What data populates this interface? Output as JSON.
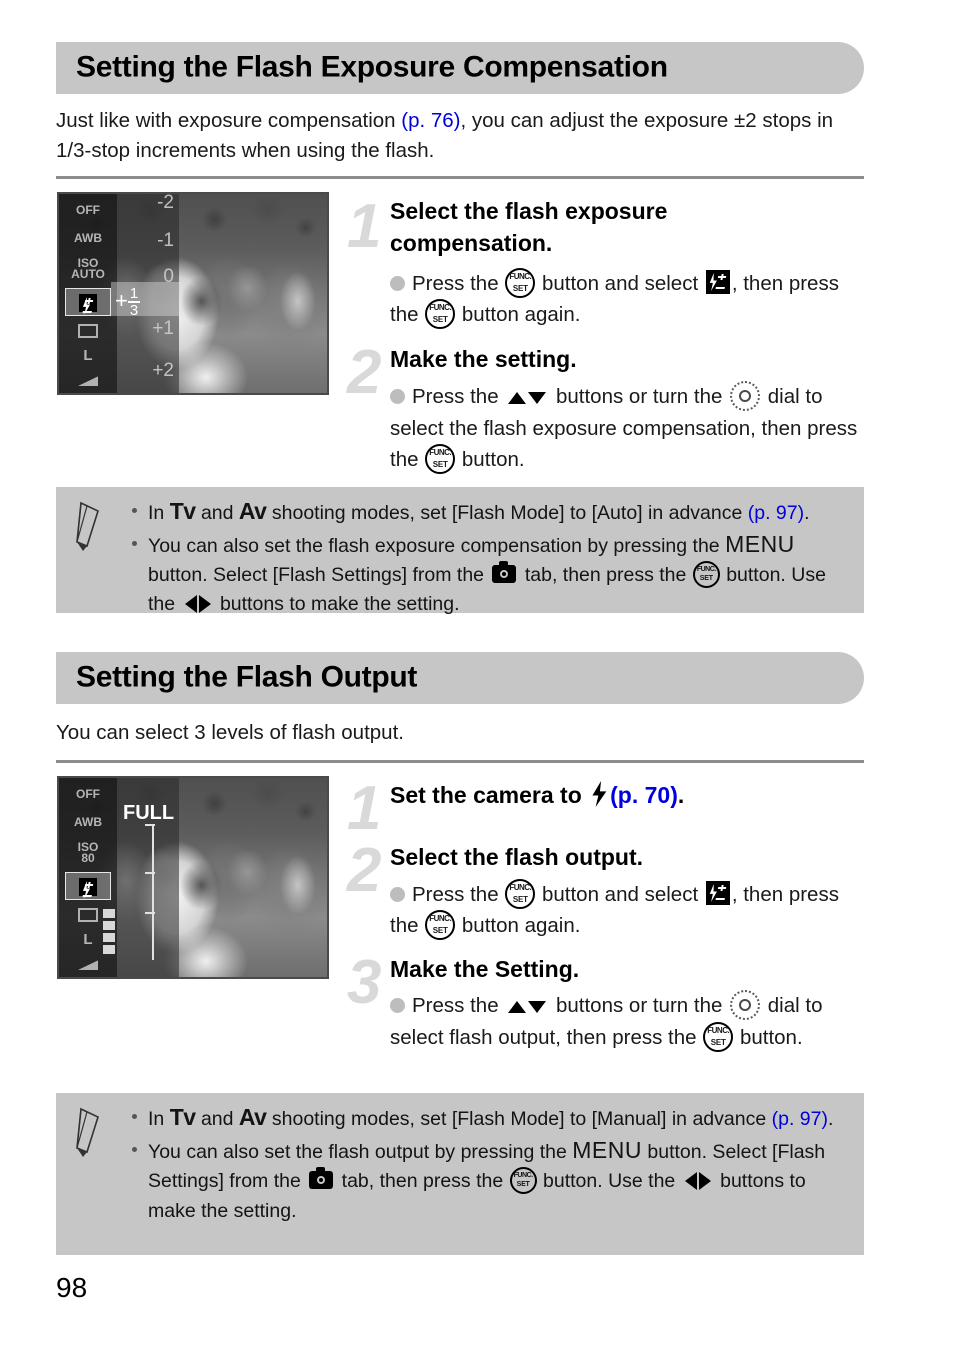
{
  "page": {
    "number": "98"
  },
  "sections": [
    {
      "id": "flash-exposure-compensation",
      "title": "Setting the Flash Exposure Compensation",
      "intro_before_link": "Just like with exposure compensation ",
      "intro_link": "(p. 76)",
      "intro_after_link": ", you can adjust the exposure ±2 stops in 1/3-stop increments when using the flash.",
      "lcd": {
        "sidebar_items": [
          "OFF",
          "AWB",
          "ISO AUTO",
          "flash-comp-icon",
          "drive-icon",
          "L",
          "quality-icon"
        ],
        "iso_label": "ISO",
        "iso_value": "AUTO",
        "scale_labels": [
          "-2",
          "-1",
          "0",
          "+1",
          "+2"
        ],
        "current_value_sign": "+",
        "current_value_numerator": "1",
        "current_value_denominator": "3",
        "alt": "Camera LCD showing flash exposure compensation scale set to +1/3"
      },
      "steps": [
        {
          "number": "1",
          "title": "Select the flash exposure compensation.",
          "body_parts": [
            "Press the ",
            "funcset-icon",
            " button and select ",
            "flash-comp-icon",
            ", then press the ",
            "funcset-icon",
            " button again."
          ],
          "body_text": "Press the (FUNC.SET) button and select [flash exposure compensation icon], then press the (FUNC.SET) button again."
        },
        {
          "number": "2",
          "title": "Make the setting.",
          "body_text": "Press the ▲▼ buttons or turn the ○ dial to select the flash exposure compensation, then press the (FUNC.SET) button."
        }
      ],
      "note": {
        "items": [
          {
            "text_segments": [
              {
                "t": "In ",
                "style": "normal"
              },
              {
                "t": "Tv",
                "style": "mode"
              },
              {
                "t": " and ",
                "style": "normal"
              },
              {
                "t": "Av",
                "style": "mode"
              },
              {
                "t": " shooting modes, set [Flash Mode] to [Auto] in advance ",
                "style": "normal"
              },
              {
                "t": "(p. 97)",
                "style": "link"
              },
              {
                "t": ".",
                "style": "normal"
              }
            ],
            "plain": "In Tv and Av shooting modes, set [Flash Mode] to [Auto] in advance (p. 97)."
          },
          {
            "plain": "You can also set the flash exposure compensation by pressing the MENU button. Select [Flash Settings] from the [camera] tab, then press the (FUNC.SET) button. Use the ◀▶ buttons to make the setting."
          }
        ]
      }
    },
    {
      "id": "flash-output",
      "title": "Setting the Flash Output",
      "intro": "You can select 3 levels of flash output.",
      "lcd": {
        "sidebar_items": [
          "OFF",
          "AWB",
          "ISO 80",
          "flash-comp-icon",
          "drive-icon",
          "L",
          "quality-icon"
        ],
        "iso_label": "ISO",
        "iso_value": "80",
        "full_label": "FULL",
        "alt": "Camera LCD showing flash output set to FULL"
      },
      "steps": [
        {
          "number": "1",
          "title_before": "Set the camera to ",
          "title_icon": "flash-bolt-icon",
          "title_link": "(p. 70)",
          "title_after": ".",
          "title_plain": "Set the camera to ⚡ (p. 70)."
        },
        {
          "number": "2",
          "title": "Select the flash output.",
          "body_text": "Press the (FUNC.SET) button and select [flash exposure compensation icon], then press the (FUNC.SET) button again."
        },
        {
          "number": "3",
          "title": "Make the Setting.",
          "body_text": "Press the ▲▼ buttons or turn the ○ dial to select flash output, then press the (FUNC.SET) button."
        }
      ],
      "note": {
        "items": [
          {
            "plain": "In Tv and Av shooting modes, set [Flash Mode] to [Manual] in advance (p. 97)."
          },
          {
            "plain": "You can also set the flash output by pressing the MENU button. Select [Flash Settings] from the [camera] tab, then press the (FUNC.SET) button. Use the ◀▶ buttons to make the setting."
          }
        ]
      }
    }
  ],
  "strings": {
    "press_the": "Press the ",
    "button_and_select": " button and select ",
    "then_press_the": ", then press the ",
    "button_again": " button again.",
    "press_the2": "Press the ",
    "buttons_or_turn_the": " buttons or turn the ",
    "dial_to_select_fec": " dial to select the flash exposure compensation, then press the ",
    "dial_to_select_fo": " dial to select flash output, then press the ",
    "button_period": " button.",
    "in_": "In ",
    "tv": "Tv",
    "and_": " and ",
    "av": "Av",
    "shooting_modes_auto": " shooting modes, set [Flash Mode] to [Auto] in advance ",
    "shooting_modes_manual": " shooting modes, set [Flash Mode] to [Manual] in ",
    "advance_": "advance ",
    "p97": "(p. 97)",
    "period": ".",
    "you_can_also_fec": "You can also set the flash exposure compensation by pressing the ",
    "you_can_also_fo": "You can also set the flash output by pressing the ",
    "menu": "MENU",
    "button_select_flash_settings": " button. Select [Flash Settings] from the ",
    "tab_then_press_the": " tab, then press the ",
    "button_use_the": " button. Use the ",
    "buttons_to_make_the_setting": " buttons to make the setting.",
    "set_the_camera_to": "Set the camera to ",
    "p70": "(p. 70)",
    "p76": "(p. 76)"
  },
  "colors": {
    "banner_bg": "#c6c6c6",
    "note_bg": "#c6c6c6",
    "link": "#0000dd",
    "step_number": "#d9d9d9",
    "rule": "#8c8c8c",
    "bullet": "#bdbdbd"
  }
}
